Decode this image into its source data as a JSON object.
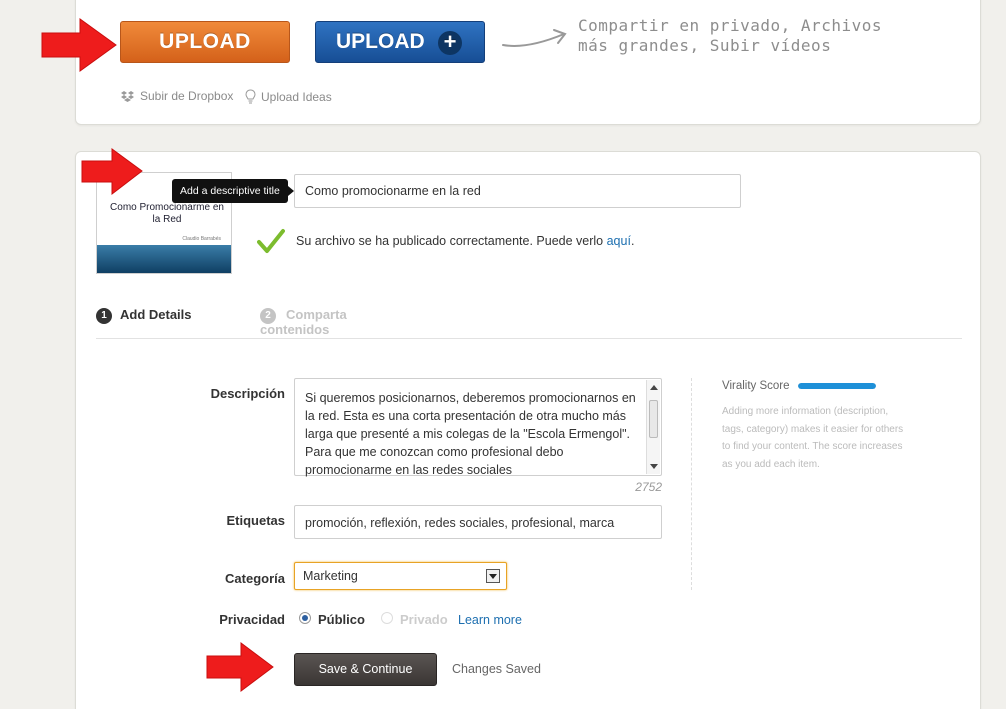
{
  "upload": {
    "upload_label": "UPLOAD",
    "upload_plus_label": "UPLOAD",
    "plus_symbol": "+",
    "note_line1": "Compartir en privado, Archivos",
    "note_line2": "más grandes, Subir vídeos",
    "dropbox_link": "Subir de Dropbox",
    "ideas_link": "Upload Ideas"
  },
  "form": {
    "thumb_title": "Como Promocionarme en la Red",
    "thumb_author": "Claudio Barrabés",
    "tooltip": "Add a descriptive title",
    "title_value": "Como promocionarme en la red",
    "status_text": "Su archivo se ha publicado correctamente. Puede verlo ",
    "status_link": "aquí",
    "status_end": ".",
    "steps": [
      {
        "num": "1",
        "label": "Add Details"
      },
      {
        "num": "2",
        "label": "Comparta contenidos"
      }
    ],
    "description_label": "Descripción",
    "description_value": "Si queremos posicionarnos, deberemos promocionarnos en la red. Esta es una corta presentación de otra mucho más larga que presenté a mis colegas de la \"Escola Ermengol\". Para que me conozcan como profesional debo promocionarme en las redes sociales",
    "char_count": "2752",
    "tags_label": "Etiquetas",
    "tags_value": "promoción, reflexión, redes sociales, profesional, marca",
    "category_label": "Categoría",
    "category_value": "Marketing",
    "privacy_label": "Privacidad",
    "privacy_public": "Público",
    "privacy_private": "Privado",
    "learn_more": "Learn more",
    "save_button": "Save & Continue",
    "changes_saved": "Changes Saved"
  },
  "virality": {
    "label": "Virality Score",
    "score_fraction": 1.0,
    "help_text": "Adding more information (description, tags, category) makes it easier for others to find your content. The score increases as you add each item."
  },
  "colors": {
    "upload_orange": "#e0712a",
    "upload_blue": "#1f5fa8",
    "arrow_red": "#ee1c1c",
    "link_blue": "#1d6fb0",
    "check_green": "#7cbc2e",
    "virality_blue": "#1e90d8"
  }
}
